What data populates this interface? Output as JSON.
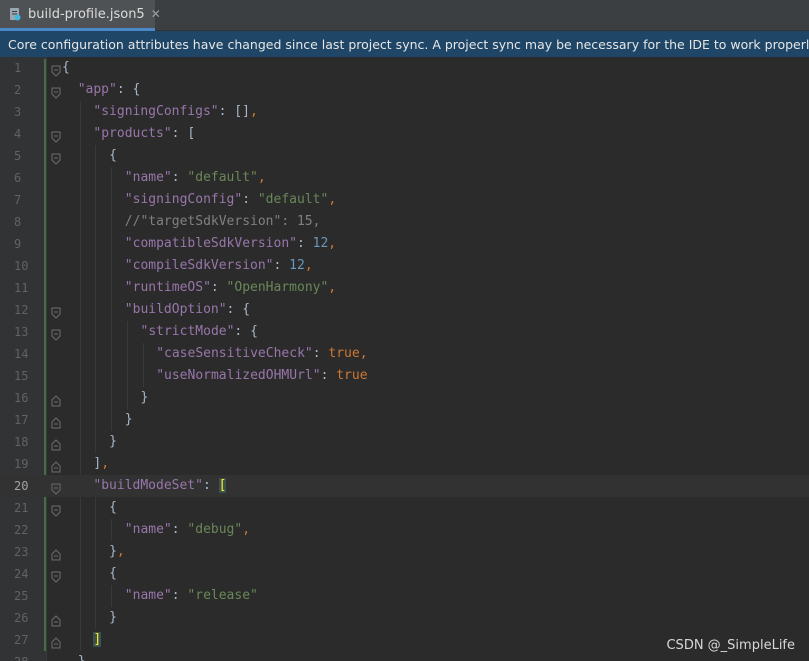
{
  "tab": {
    "title": "build-profile.json5",
    "close_glyph": "✕",
    "icon": "json-file-icon"
  },
  "banner": {
    "text": "Core configuration attributes have changed since last project sync. A project sync may be necessary for the IDE to work properly."
  },
  "editor": {
    "current_line": 20,
    "lines": [
      {
        "n": "1",
        "indent": 0,
        "tokens": [
          [
            "p",
            "{"
          ]
        ]
      },
      {
        "n": "2",
        "indent": 1,
        "tokens": [
          [
            "k",
            "\"app\""
          ],
          [
            "p",
            ": {"
          ]
        ]
      },
      {
        "n": "3",
        "indent": 2,
        "tokens": [
          [
            "k",
            "\"signingConfigs\""
          ],
          [
            "p",
            ": []"
          ],
          [
            "b",
            ","
          ]
        ]
      },
      {
        "n": "4",
        "indent": 2,
        "tokens": [
          [
            "k",
            "\"products\""
          ],
          [
            "p",
            ": ["
          ]
        ]
      },
      {
        "n": "5",
        "indent": 3,
        "tokens": [
          [
            "p",
            "{"
          ]
        ]
      },
      {
        "n": "6",
        "indent": 4,
        "tokens": [
          [
            "k",
            "\"name\""
          ],
          [
            "p",
            ": "
          ],
          [
            "s",
            "\"default\""
          ],
          [
            "b",
            ","
          ]
        ]
      },
      {
        "n": "7",
        "indent": 4,
        "tokens": [
          [
            "k",
            "\"signingConfig\""
          ],
          [
            "p",
            ": "
          ],
          [
            "s",
            "\"default\""
          ],
          [
            "b",
            ","
          ]
        ]
      },
      {
        "n": "8",
        "indent": 4,
        "tokens": [
          [
            "c",
            "//\"targetSdkVersion\": 15,"
          ]
        ]
      },
      {
        "n": "9",
        "indent": 4,
        "tokens": [
          [
            "k",
            "\"compatibleSdkVersion\""
          ],
          [
            "p",
            ": "
          ],
          [
            "n",
            "12"
          ],
          [
            "b",
            ","
          ]
        ]
      },
      {
        "n": "10",
        "indent": 4,
        "tokens": [
          [
            "k",
            "\"compileSdkVersion\""
          ],
          [
            "p",
            ": "
          ],
          [
            "n",
            "12"
          ],
          [
            "b",
            ","
          ]
        ]
      },
      {
        "n": "11",
        "indent": 4,
        "tokens": [
          [
            "k",
            "\"runtimeOS\""
          ],
          [
            "p",
            ": "
          ],
          [
            "s",
            "\"OpenHarmony\""
          ],
          [
            "b",
            ","
          ]
        ]
      },
      {
        "n": "12",
        "indent": 4,
        "tokens": [
          [
            "k",
            "\"buildOption\""
          ],
          [
            "p",
            ": {"
          ]
        ]
      },
      {
        "n": "13",
        "indent": 5,
        "tokens": [
          [
            "k",
            "\"strictMode\""
          ],
          [
            "p",
            ": {"
          ]
        ]
      },
      {
        "n": "14",
        "indent": 6,
        "tokens": [
          [
            "k",
            "\"caseSensitiveCheck\""
          ],
          [
            "p",
            ": "
          ],
          [
            "b",
            "true"
          ],
          [
            "b",
            ","
          ]
        ]
      },
      {
        "n": "15",
        "indent": 6,
        "tokens": [
          [
            "k",
            "\"useNormalizedOHMUrl\""
          ],
          [
            "p",
            ": "
          ],
          [
            "b",
            "true"
          ]
        ]
      },
      {
        "n": "16",
        "indent": 5,
        "tokens": [
          [
            "p",
            "}"
          ]
        ]
      },
      {
        "n": "17",
        "indent": 4,
        "tokens": [
          [
            "p",
            "}"
          ]
        ]
      },
      {
        "n": "18",
        "indent": 3,
        "tokens": [
          [
            "p",
            "}"
          ]
        ]
      },
      {
        "n": "19",
        "indent": 2,
        "tokens": [
          [
            "p",
            "]"
          ],
          [
            "b",
            ","
          ]
        ]
      },
      {
        "n": "20",
        "indent": 2,
        "tokens": [
          [
            "k",
            "\"buildModeSet\""
          ],
          [
            "p",
            ": "
          ],
          [
            "hl",
            "["
          ]
        ]
      },
      {
        "n": "21",
        "indent": 3,
        "tokens": [
          [
            "p",
            "{"
          ]
        ]
      },
      {
        "n": "22",
        "indent": 4,
        "tokens": [
          [
            "k",
            "\"name\""
          ],
          [
            "p",
            ": "
          ],
          [
            "s",
            "\"debug\""
          ],
          [
            "b",
            ","
          ]
        ]
      },
      {
        "n": "23",
        "indent": 3,
        "tokens": [
          [
            "p",
            "}"
          ],
          [
            "b",
            ","
          ]
        ]
      },
      {
        "n": "24",
        "indent": 3,
        "tokens": [
          [
            "p",
            "{"
          ]
        ]
      },
      {
        "n": "25",
        "indent": 4,
        "tokens": [
          [
            "k",
            "\"name\""
          ],
          [
            "p",
            ": "
          ],
          [
            "s",
            "\"release\""
          ]
        ]
      },
      {
        "n": "26",
        "indent": 3,
        "tokens": [
          [
            "p",
            "}"
          ]
        ]
      },
      {
        "n": "27",
        "indent": 2,
        "tokens": [
          [
            "hl",
            "]"
          ]
        ]
      },
      {
        "n": "28",
        "indent": 1,
        "tokens": [
          [
            "p",
            "}"
          ]
        ]
      }
    ],
    "fold_lines": [
      "1",
      "2",
      "4",
      "5",
      "12",
      "13",
      "16",
      "17",
      "18",
      "19",
      "20",
      "21",
      "23",
      "24",
      "26",
      "27"
    ]
  },
  "watermark": {
    "text": "CSDN @_SimpleLife"
  },
  "colors": {
    "background": "#2b2b2b",
    "gutter": "#313335",
    "banner": "#1f4667",
    "key": "#9876aa",
    "string": "#6a8759",
    "number": "#6897bb",
    "keyword": "#cc7832",
    "comment": "#808080",
    "bracket_highlight": "#ffef28"
  }
}
